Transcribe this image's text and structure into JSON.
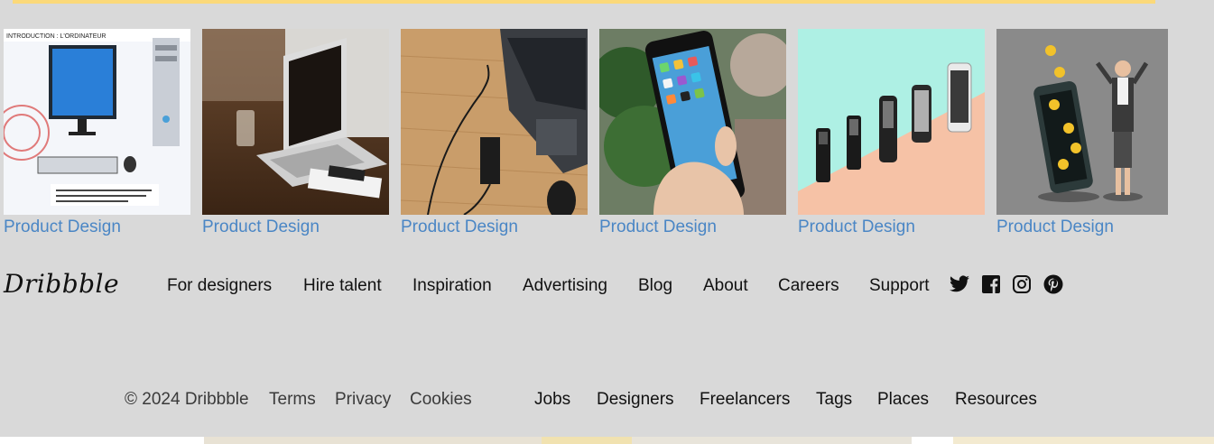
{
  "shots": [
    {
      "label": "Product Design",
      "image": "desktop-computer-photo"
    },
    {
      "label": "Product Design",
      "image": "laptop-on-table-photo"
    },
    {
      "label": "Product Design",
      "image": "laptop-charger-photo"
    },
    {
      "label": "Product Design",
      "image": "smartphone-in-hand-photo"
    },
    {
      "label": "Product Design",
      "image": "phone-evolution-photo"
    },
    {
      "label": "Product Design",
      "image": "phone-illustration-photo"
    }
  ],
  "brand": {
    "logo": "Dribbble"
  },
  "nav": {
    "items": [
      "For designers",
      "Hire talent",
      "Inspiration",
      "Advertising",
      "Blog",
      "About",
      "Careers",
      "Support"
    ]
  },
  "social": [
    "twitter-icon",
    "facebook-icon",
    "instagram-icon",
    "pinterest-icon"
  ],
  "footer": {
    "copyright": "© 2024 Dribbble",
    "legal": [
      "Terms",
      "Privacy",
      "Cookies"
    ],
    "directory": [
      "Jobs",
      "Designers",
      "Freelancers",
      "Tags",
      "Places",
      "Resources"
    ]
  },
  "colors": {
    "background": "#d9d9d9",
    "link": "#4a86c5",
    "accent_bar": "#fbd97a",
    "text": "#111111"
  }
}
